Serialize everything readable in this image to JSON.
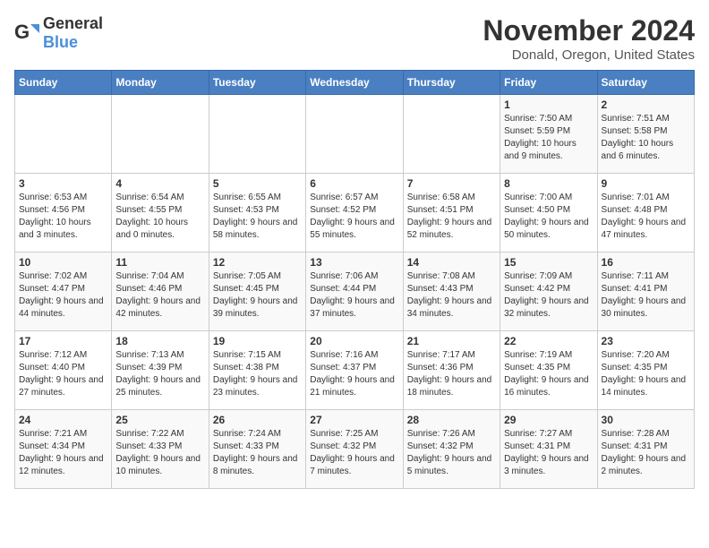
{
  "header": {
    "logo_general": "General",
    "logo_blue": "Blue",
    "month": "November 2024",
    "location": "Donald, Oregon, United States"
  },
  "days_of_week": [
    "Sunday",
    "Monday",
    "Tuesday",
    "Wednesday",
    "Thursday",
    "Friday",
    "Saturday"
  ],
  "weeks": [
    [
      {
        "day": "",
        "detail": ""
      },
      {
        "day": "",
        "detail": ""
      },
      {
        "day": "",
        "detail": ""
      },
      {
        "day": "",
        "detail": ""
      },
      {
        "day": "",
        "detail": ""
      },
      {
        "day": "1",
        "detail": "Sunrise: 7:50 AM\nSunset: 5:59 PM\nDaylight: 10 hours and 9 minutes."
      },
      {
        "day": "2",
        "detail": "Sunrise: 7:51 AM\nSunset: 5:58 PM\nDaylight: 10 hours and 6 minutes."
      }
    ],
    [
      {
        "day": "3",
        "detail": "Sunrise: 6:53 AM\nSunset: 4:56 PM\nDaylight: 10 hours and 3 minutes."
      },
      {
        "day": "4",
        "detail": "Sunrise: 6:54 AM\nSunset: 4:55 PM\nDaylight: 10 hours and 0 minutes."
      },
      {
        "day": "5",
        "detail": "Sunrise: 6:55 AM\nSunset: 4:53 PM\nDaylight: 9 hours and 58 minutes."
      },
      {
        "day": "6",
        "detail": "Sunrise: 6:57 AM\nSunset: 4:52 PM\nDaylight: 9 hours and 55 minutes."
      },
      {
        "day": "7",
        "detail": "Sunrise: 6:58 AM\nSunset: 4:51 PM\nDaylight: 9 hours and 52 minutes."
      },
      {
        "day": "8",
        "detail": "Sunrise: 7:00 AM\nSunset: 4:50 PM\nDaylight: 9 hours and 50 minutes."
      },
      {
        "day": "9",
        "detail": "Sunrise: 7:01 AM\nSunset: 4:48 PM\nDaylight: 9 hours and 47 minutes."
      }
    ],
    [
      {
        "day": "10",
        "detail": "Sunrise: 7:02 AM\nSunset: 4:47 PM\nDaylight: 9 hours and 44 minutes."
      },
      {
        "day": "11",
        "detail": "Sunrise: 7:04 AM\nSunset: 4:46 PM\nDaylight: 9 hours and 42 minutes."
      },
      {
        "day": "12",
        "detail": "Sunrise: 7:05 AM\nSunset: 4:45 PM\nDaylight: 9 hours and 39 minutes."
      },
      {
        "day": "13",
        "detail": "Sunrise: 7:06 AM\nSunset: 4:44 PM\nDaylight: 9 hours and 37 minutes."
      },
      {
        "day": "14",
        "detail": "Sunrise: 7:08 AM\nSunset: 4:43 PM\nDaylight: 9 hours and 34 minutes."
      },
      {
        "day": "15",
        "detail": "Sunrise: 7:09 AM\nSunset: 4:42 PM\nDaylight: 9 hours and 32 minutes."
      },
      {
        "day": "16",
        "detail": "Sunrise: 7:11 AM\nSunset: 4:41 PM\nDaylight: 9 hours and 30 minutes."
      }
    ],
    [
      {
        "day": "17",
        "detail": "Sunrise: 7:12 AM\nSunset: 4:40 PM\nDaylight: 9 hours and 27 minutes."
      },
      {
        "day": "18",
        "detail": "Sunrise: 7:13 AM\nSunset: 4:39 PM\nDaylight: 9 hours and 25 minutes."
      },
      {
        "day": "19",
        "detail": "Sunrise: 7:15 AM\nSunset: 4:38 PM\nDaylight: 9 hours and 23 minutes."
      },
      {
        "day": "20",
        "detail": "Sunrise: 7:16 AM\nSunset: 4:37 PM\nDaylight: 9 hours and 21 minutes."
      },
      {
        "day": "21",
        "detail": "Sunrise: 7:17 AM\nSunset: 4:36 PM\nDaylight: 9 hours and 18 minutes."
      },
      {
        "day": "22",
        "detail": "Sunrise: 7:19 AM\nSunset: 4:35 PM\nDaylight: 9 hours and 16 minutes."
      },
      {
        "day": "23",
        "detail": "Sunrise: 7:20 AM\nSunset: 4:35 PM\nDaylight: 9 hours and 14 minutes."
      }
    ],
    [
      {
        "day": "24",
        "detail": "Sunrise: 7:21 AM\nSunset: 4:34 PM\nDaylight: 9 hours and 12 minutes."
      },
      {
        "day": "25",
        "detail": "Sunrise: 7:22 AM\nSunset: 4:33 PM\nDaylight: 9 hours and 10 minutes."
      },
      {
        "day": "26",
        "detail": "Sunrise: 7:24 AM\nSunset: 4:33 PM\nDaylight: 9 hours and 8 minutes."
      },
      {
        "day": "27",
        "detail": "Sunrise: 7:25 AM\nSunset: 4:32 PM\nDaylight: 9 hours and 7 minutes."
      },
      {
        "day": "28",
        "detail": "Sunrise: 7:26 AM\nSunset: 4:32 PM\nDaylight: 9 hours and 5 minutes."
      },
      {
        "day": "29",
        "detail": "Sunrise: 7:27 AM\nSunset: 4:31 PM\nDaylight: 9 hours and 3 minutes."
      },
      {
        "day": "30",
        "detail": "Sunrise: 7:28 AM\nSunset: 4:31 PM\nDaylight: 9 hours and 2 minutes."
      }
    ]
  ]
}
